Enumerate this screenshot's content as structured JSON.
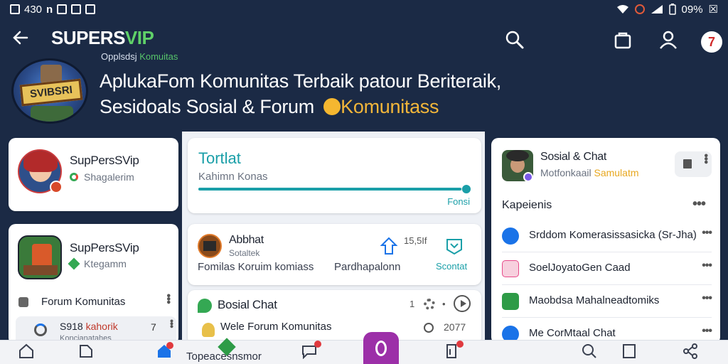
{
  "status_bar": {
    "time": "430",
    "battery": "09%"
  },
  "header": {
    "brand": "SUPERS",
    "brand_vip": "VIP",
    "brand_sub": "Opplsdsj",
    "brand_sub_green": "Komuitas",
    "headline_1": "AplukaFom Komunitas Terbaik patour Beriteraik,",
    "headline_2": "Sesidoals  Sosial & Forum",
    "headline_highlight": "Komunitass",
    "logo_text": "SVIBSRI",
    "notification_count": "7"
  },
  "cards": {
    "profile1": {
      "name": "SupPersSVip",
      "sub": "Shagalerim"
    },
    "total": {
      "title": "Tortlat",
      "sub": "Kahimn Konas",
      "link": "Fonsi",
      "progress": 0.98
    },
    "social_chat": {
      "title": "Sosial & Chat",
      "sub_plain": "Motfonkaail",
      "sub_highlight": "Samulatm"
    },
    "profile2": {
      "name": "SupPersSVip",
      "sub": "Ktegamm",
      "forum_label": "Forum Komunitas",
      "bottom_name": "S918",
      "bottom_highlight": "kahorik",
      "bottom_count": "7",
      "bottom_sub": "Koncianatahes"
    },
    "abhat": {
      "name": "Abbhat",
      "sub": "Sotaltek",
      "count": "15,5If",
      "desc_1": "Fomilas Koruim komiass",
      "desc_2": "Pardhapalonn",
      "link": "Scontat"
    },
    "chat": {
      "title": "Bosial Chat",
      "num": "1",
      "sub": "Wele Forum Komunitas",
      "count": "2077"
    }
  },
  "kapeienis": {
    "title": "Kapeienis",
    "items": [
      {
        "label": "Srddom Komerasissasicka (Sr-Jha)",
        "color": "#1a73e8"
      },
      {
        "label": "SoelJoyatoGen Caad",
        "color": "#e84a8a"
      },
      {
        "label": "Maobdsa Mahalneadtomiks",
        "color": "#2e9b47"
      },
      {
        "label": "Me CorMtaal Chat",
        "color": "#1a73e8"
      }
    ]
  },
  "bottom_nav": {
    "label": "Topeacesnsmor",
    "items": [
      "home",
      "edit",
      "community",
      "chat",
      "fab",
      "clip",
      "search",
      "square",
      "share"
    ]
  }
}
